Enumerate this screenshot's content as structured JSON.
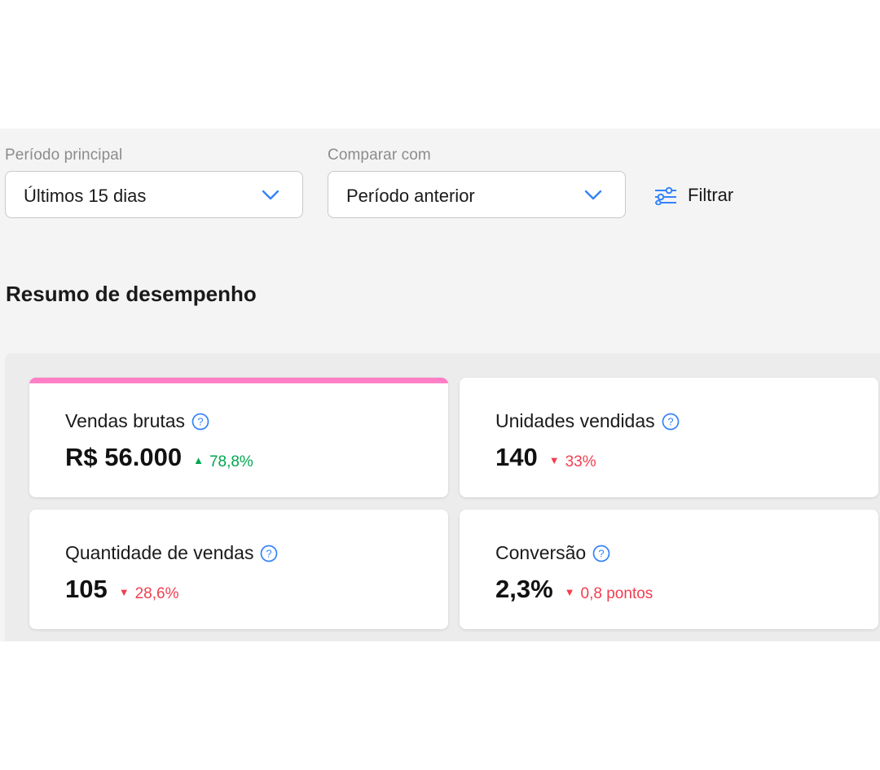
{
  "filters": {
    "primary_label": "Período principal",
    "primary_value": "Últimos 15 dias",
    "compare_label": "Comparar com",
    "compare_value": "Período anterior",
    "filter_button": "Filtrar"
  },
  "summary": {
    "title": "Resumo de desempenho",
    "cards": [
      {
        "title": "Vendas brutas",
        "value": "R$ 56.000",
        "delta": "78,8%",
        "direction": "up"
      },
      {
        "title": "Unidades vendidas",
        "value": "140",
        "delta": "33%",
        "direction": "down"
      },
      {
        "title": "Quantidade de vendas",
        "value": "105",
        "delta": "28,6%",
        "direction": "down"
      },
      {
        "title": "Conversão",
        "value": "2,3%",
        "delta": "0,8 pontos",
        "direction": "down"
      }
    ]
  },
  "icons": {
    "up_arrow": "▲",
    "down_arrow": "▼",
    "help": "help-circle-icon",
    "filter": "sliders-icon",
    "chevron": "chevron-down-icon"
  },
  "colors": {
    "accent": "#3483fa",
    "positive": "#00a650",
    "negative": "#f23d4f",
    "highlight_bar": "#ff7fc6"
  }
}
